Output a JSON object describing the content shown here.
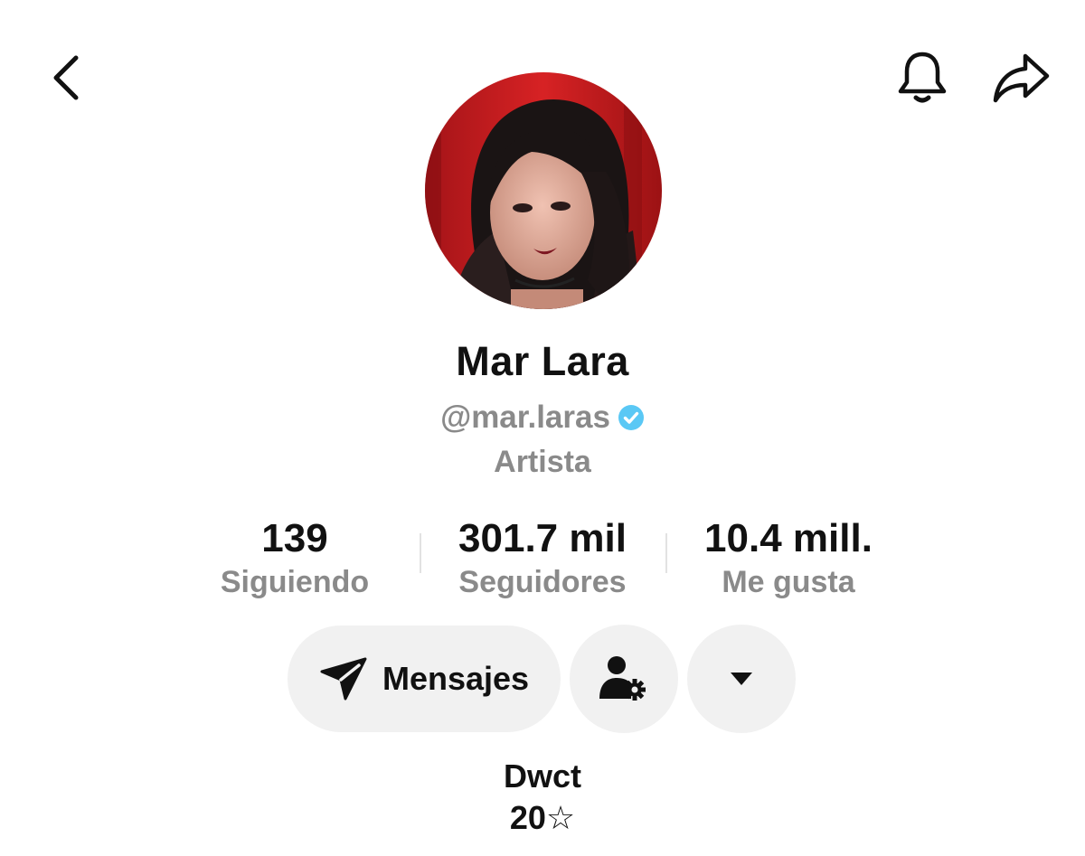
{
  "header": {
    "back_icon": "chevron-left-icon",
    "notifications_icon": "bell-icon",
    "share_icon": "share-arrow-icon"
  },
  "profile": {
    "display_name": "Mar Lara",
    "username": "@mar.laras",
    "verified": true,
    "category": "Artista"
  },
  "stats": {
    "following": {
      "value": "139",
      "label": "Siguiendo"
    },
    "followers": {
      "value": "301.7 mil",
      "label": "Seguidores"
    },
    "likes": {
      "value": "10.4 mill.",
      "label": "Me gusta"
    }
  },
  "actions": {
    "messages_label": "Mensajes",
    "messages_icon": "send-icon",
    "manage_icon": "user-settings-icon",
    "more_icon": "caret-down-icon"
  },
  "bio": {
    "line1": "Dwct",
    "line2": "20☆"
  },
  "colors": {
    "text": "#111111",
    "muted": "#8a8a8a",
    "button_bg": "#f1f1f1",
    "verified": "#5ac8f5"
  }
}
